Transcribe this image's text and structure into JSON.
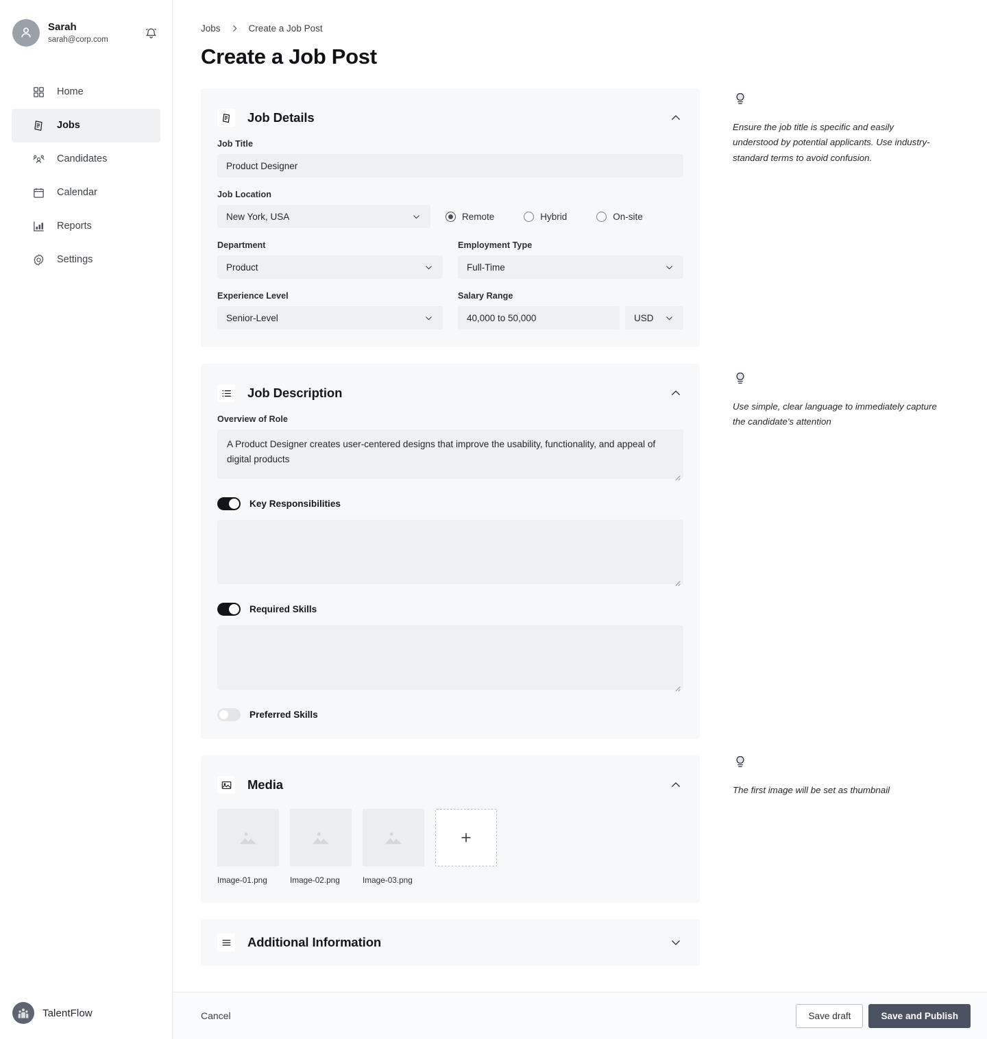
{
  "sidebar": {
    "user": {
      "name": "Sarah",
      "email": "sarah@corp.com",
      "avatar_icon": "user-icon"
    },
    "notification_icon": "bell-icon",
    "items": [
      {
        "label": "Home",
        "icon": "grid-icon",
        "active": false
      },
      {
        "label": "Jobs",
        "icon": "document-icon",
        "active": true
      },
      {
        "label": "Candidates",
        "icon": "people-icon",
        "active": false
      },
      {
        "label": "Calendar",
        "icon": "calendar-icon",
        "active": false
      },
      {
        "label": "Reports",
        "icon": "bar-chart-icon",
        "active": false
      },
      {
        "label": "Settings",
        "icon": "gear-icon",
        "active": false
      }
    ],
    "brand": {
      "name": "TalentFlow",
      "logo_icon": "people-circle-logo"
    }
  },
  "breadcrumb": {
    "root": "Jobs",
    "current": "Create a Job Post",
    "separator_icon": "chevron-right-icon"
  },
  "page": {
    "title": "Create a Job Post"
  },
  "sections": {
    "job_details": {
      "title": "Job Details",
      "icon": "document-icon",
      "collapse_icon": "chevron-up-icon",
      "job_title": {
        "label": "Job Title",
        "value": "Product Designer"
      },
      "job_location": {
        "label": "Job Location",
        "value": "New York, USA"
      },
      "work_mode": {
        "options": [
          {
            "label": "Remote",
            "selected": true
          },
          {
            "label": "Hybrid",
            "selected": false
          },
          {
            "label": "On-site",
            "selected": false
          }
        ]
      },
      "department": {
        "label": "Department",
        "value": "Product"
      },
      "employment_type": {
        "label": "Employment Type",
        "value": "Full-Time"
      },
      "experience_level": {
        "label": "Experience Level",
        "value": "Senior-Level"
      },
      "salary_range": {
        "label": "Salary Range",
        "value": "40,000 to 50,000",
        "currency": "USD"
      }
    },
    "job_description": {
      "title": "Job Description",
      "icon": "list-icon",
      "collapse_icon": "chevron-up-icon",
      "overview": {
        "label": "Overview of Role",
        "value": "A Product Designer creates user-centered designs that improve the usability, functionality, and appeal of digital products"
      },
      "key_responsibilities": {
        "label": "Key Responsibilities",
        "enabled": true,
        "value": ""
      },
      "required_skills": {
        "label": "Required Skills",
        "enabled": true,
        "value": ""
      },
      "preferred_skills": {
        "label": "Preferred Skills",
        "enabled": false
      }
    },
    "media": {
      "title": "Media",
      "icon": "image-icon",
      "collapse_icon": "chevron-up-icon",
      "files": [
        {
          "name": "Image-01.png",
          "icon": "image-placeholder-icon"
        },
        {
          "name": "Image-02.png",
          "icon": "image-placeholder-icon"
        },
        {
          "name": "Image-03.png",
          "icon": "image-placeholder-icon"
        }
      ],
      "add_icon": "plus-icon"
    },
    "additional_information": {
      "title": "Additional Information",
      "icon": "hamburger-icon",
      "collapse_icon": "chevron-down-icon"
    }
  },
  "tips": [
    {
      "icon": "lightbulb-icon",
      "text": "Ensure the job title is specific and easily understood by potential applicants. Use industry-standard terms to avoid confusion."
    },
    {
      "icon": "lightbulb-icon",
      "text": "Use simple, clear language to immediately capture the candidate's attention"
    },
    {
      "icon": "lightbulb-icon",
      "text": "The first image will be set as thumbnail"
    }
  ],
  "footer": {
    "cancel_label": "Cancel",
    "save_draft_label": "Save draft",
    "save_publish_label": "Save and Publish"
  },
  "colors": {
    "panel_bg": "#f6f8f9",
    "input_bg": "#eef0f2",
    "publish_btn": "#4b5262",
    "active_nav_bg": "#eff1f3",
    "toggle_on": "#111418"
  }
}
